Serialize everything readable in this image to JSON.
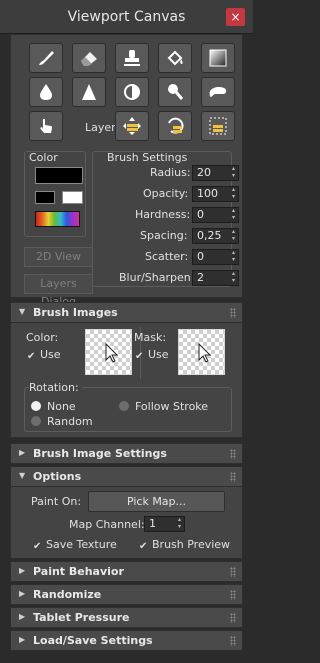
{
  "window": {
    "title": "Viewport Canvas",
    "close": "×"
  },
  "toolbar": {
    "layer_label": "Layer:"
  },
  "color": {
    "title": "Color"
  },
  "brush_settings": {
    "title": "Brush Settings",
    "radius_label": "Radius:",
    "radius": "20",
    "opacity_label": "Opacity:",
    "opacity": "100",
    "hardness_label": "Hardness:",
    "hardness": "0",
    "spacing_label": "Spacing:",
    "spacing": "0,25",
    "scatter_label": "Scatter:",
    "scatter": "0",
    "blur_label": "Blur/Sharpen:",
    "blur": "2"
  },
  "buttons": {
    "view_2d": "2D View",
    "layers_dialog": "Layers Dialog"
  },
  "brush_images": {
    "title": "Brush Images",
    "color_label": "Color:",
    "color_use": "Use",
    "mask_label": "Mask:",
    "mask_use": "Use",
    "rotation_title": "Rotation:",
    "rotation_none": "None",
    "rotation_random": "Random",
    "rotation_follow": "Follow Stroke"
  },
  "brush_image_settings": {
    "title": "Brush Image Settings"
  },
  "options": {
    "title": "Options",
    "paint_on_label": "Paint On:",
    "pick_map": "Pick Map...",
    "map_channel_label": "Map Channel:",
    "map_channel": "1",
    "save_texture": "Save Texture",
    "brush_preview": "Brush Preview"
  },
  "paint_behavior": {
    "title": "Paint Behavior"
  },
  "randomize": {
    "title": "Randomize"
  },
  "tablet_pressure": {
    "title": "Tablet Pressure"
  },
  "load_save": {
    "title": "Load/Save Settings"
  },
  "colors": {
    "accent_close": "#c4383f",
    "panel": "#444444",
    "background": "#2b2b2b"
  }
}
